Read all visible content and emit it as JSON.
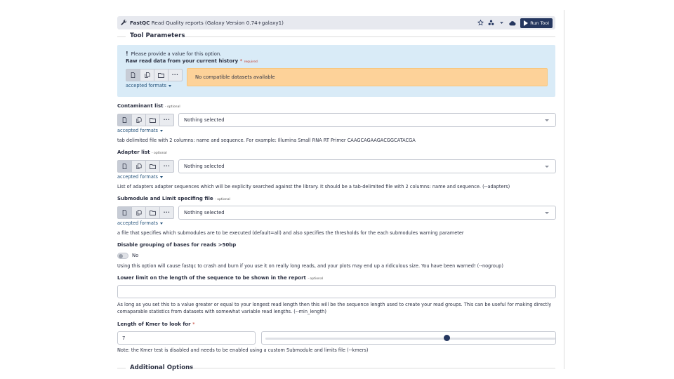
{
  "header": {
    "tool_name": "FastQC",
    "tool_desc": "Read Quality reports (Galaxy Version 0.74+galaxy1)",
    "run_label": "Run Tool"
  },
  "section_title": "Tool Parameters",
  "required_param": {
    "warning": "Please provide a value for this option.",
    "label": "Raw read data from your current history",
    "star": "*",
    "tag": "required",
    "no_data": "No compatible datasets available",
    "accepted_formats": "accepted formats"
  },
  "contaminant": {
    "label": "Contaminant list",
    "opt": "- optional",
    "value": "Nothing selected",
    "accepted_formats": "accepted formats",
    "help": "tab delimited file with 2 columns: name and sequence. For example: Illumina Small RNA RT Primer CAAGCAGAAGACGGCATACGA"
  },
  "adapter": {
    "label": "Adapter list",
    "opt": "- optional",
    "value": "Nothing selected",
    "accepted_formats": "accepted formats",
    "help": "List of adapters adapter sequences which will be explicity searched against the library. It should be a tab-delimited file with 2 columns: name and sequence. (--adapters)"
  },
  "submodule": {
    "label": "Submodule and Limit specifing file",
    "opt": "- optional",
    "value": "Nothing selected",
    "accepted_formats": "accepted formats",
    "help": "a file that specifies which submodules are to be executed (default=all) and also specifies the thresholds for the each submodules warning parameter"
  },
  "nogroup": {
    "label": "Disable grouping of bases for reads >50bp",
    "value": "No",
    "help": "Using this option will cause fastqc to crash and burn if you use it on really long reads, and your plots may end up a ridiculous size. You have been warned! (--nogroup)"
  },
  "min_length": {
    "label": "Lower limit on the length of the sequence to be shown in the report",
    "opt": "- optional",
    "value": "",
    "help": "As long as you set this to a value greater or equal to your longest read length then this will be the sequence length used to create your read groups. This can be useful for making directly comaparable statistics from datasets with somewhat variable read lengths. (--min_length)"
  },
  "kmer": {
    "label": "Length of Kmer to look for",
    "star": "*",
    "value": "7",
    "slider_fraction": 0.63,
    "help": "Note: the Kmer test is disabled and needs to be enabled using a custom Submodule and limits file (--kmers)"
  },
  "additional_title": "Additional Options"
}
